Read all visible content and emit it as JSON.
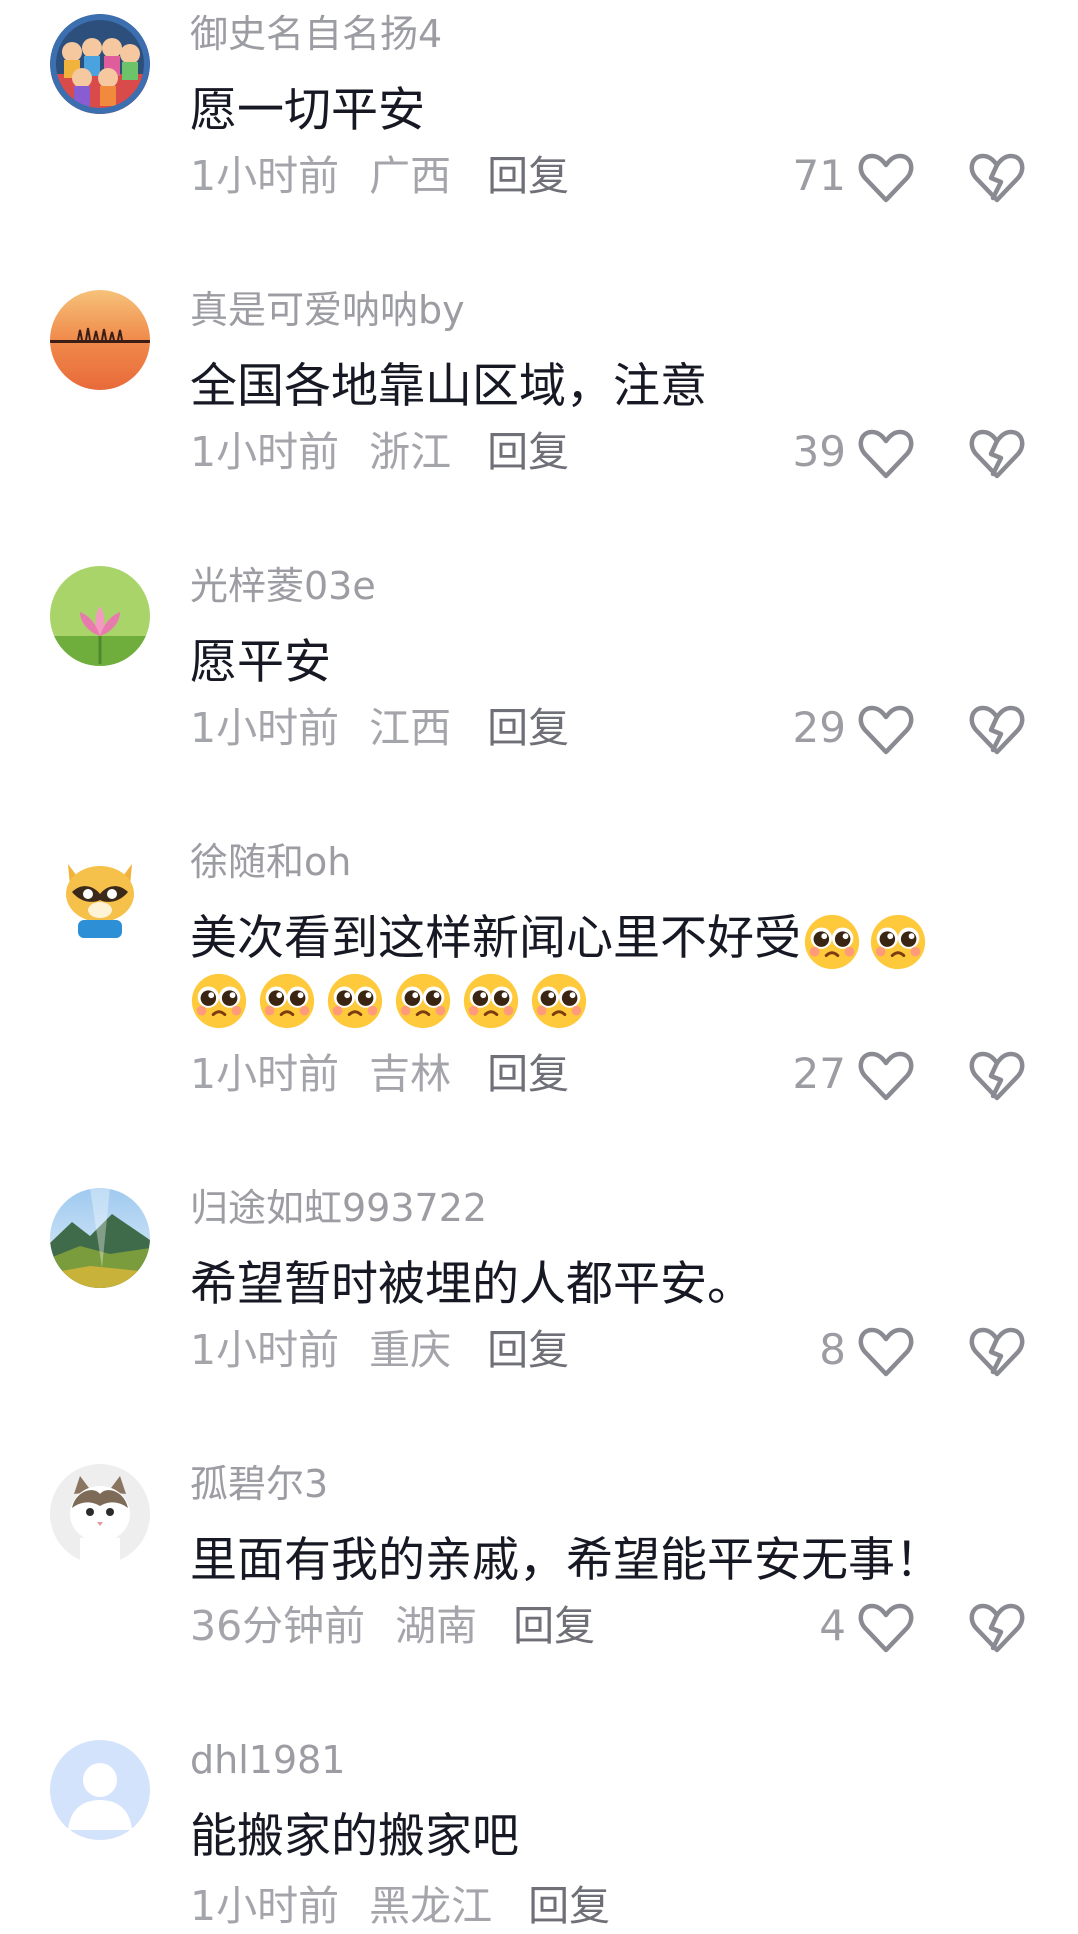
{
  "comments": [
    {
      "username": "御史名自名扬4",
      "text": "愿一切平安",
      "time": "1小时前",
      "location": "广西",
      "reply": "回复",
      "likes": "71",
      "avatar": "group-cartoon-kids"
    },
    {
      "username": "真是可爱呐呐by",
      "text": "全国各地靠山区域，注意",
      "time": "1小时前",
      "location": "浙江",
      "reply": "回复",
      "likes": "39",
      "avatar": "sunset-lake"
    },
    {
      "username": "光梓菱03e",
      "text": "愿平安",
      "time": "1小时前",
      "location": "江西",
      "reply": "回复",
      "likes": "29",
      "avatar": "lotus-flower"
    },
    {
      "username": "徐随和oh",
      "text": "美次看到这样新闻心里不好受",
      "time": "1小时前",
      "location": "吉林",
      "reply": "回复",
      "likes": "27",
      "avatar": "cartoon-raccoon",
      "emoji": "pleading-face",
      "emoji_inline_count": 2,
      "emoji_line_count": 6
    },
    {
      "username": "归途如虹993722",
      "text": "希望暂时被埋的人都平安。",
      "time": "1小时前",
      "location": "重庆",
      "reply": "回复",
      "likes": "8",
      "avatar": "mountain-landscape"
    },
    {
      "username": "孤碧尔3",
      "text": "里面有我的亲戚，希望能平安无事！",
      "time": "36分钟前",
      "location": "湖南",
      "reply": "回复",
      "likes": "4",
      "avatar": "cat-photo"
    },
    {
      "username": "dhl1981",
      "text": "能搬家的搬家吧",
      "time": "1小时前",
      "location": "黑龙江",
      "reply": "回复",
      "likes": "",
      "avatar": "default-user"
    }
  ],
  "icons": {
    "like": "heart-outline-icon",
    "dislike": "broken-heart-icon"
  },
  "colors": {
    "username": "#9c9ca3",
    "text": "#161823",
    "meta": "#a4a4ab",
    "reply": "#6f6f78",
    "icon": "#8a8a92"
  }
}
